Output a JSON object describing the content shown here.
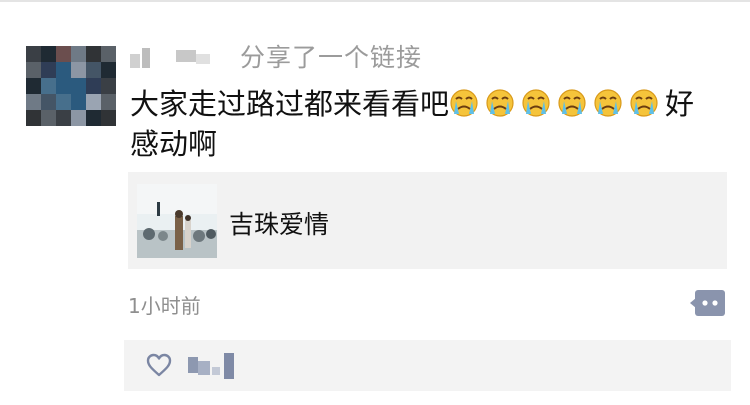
{
  "post": {
    "action_text": "分享了一个链接",
    "content_text": "大家走过路过都来看看吧",
    "content_suffix": "好感动啊",
    "emoji_count": 6,
    "emoji_name": "crying-face-icon",
    "link": {
      "title": "吉珠爱情"
    },
    "timestamp": "1小时前"
  },
  "colors": {
    "link_card_bg": "#f2f2f2",
    "secondary_text": "#9b9b9b",
    "comment_button": "#8a94ad"
  }
}
